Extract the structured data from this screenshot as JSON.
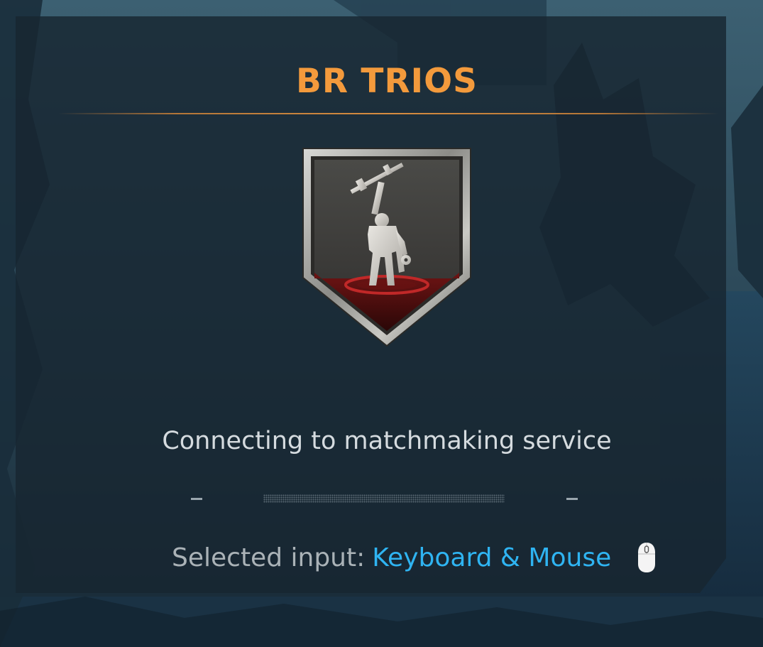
{
  "mode": {
    "title": "BR TRIOS"
  },
  "emblem": {
    "icon": "soldier-raising-rifle-emblem"
  },
  "status": {
    "message": "Connecting to matchmaking service",
    "progress": 0.0
  },
  "input": {
    "label": "Selected input:",
    "value": "Keyboard & Mouse",
    "icon": "mouse-icon"
  },
  "colors": {
    "title": "#f39a3c",
    "accent_input": "#2fb4f2",
    "status_text": "#d5dbdf",
    "panel": "#172631"
  }
}
